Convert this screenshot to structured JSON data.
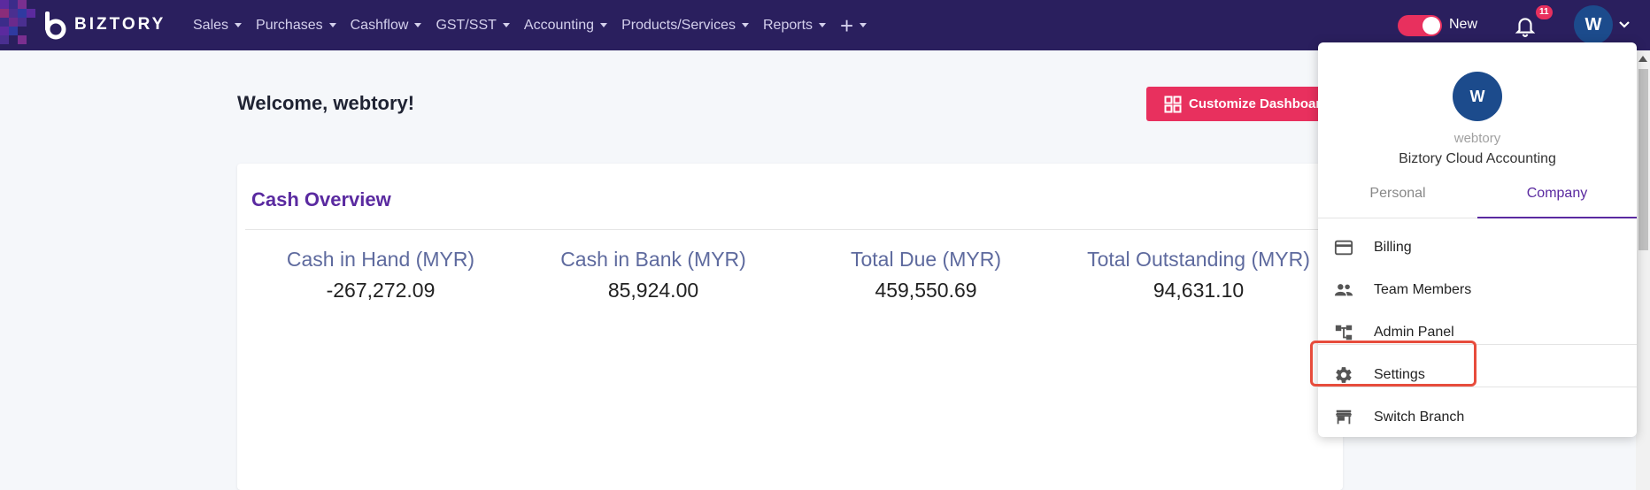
{
  "brand": {
    "name": "BIZTORY"
  },
  "nav": {
    "items": [
      {
        "label": "Sales"
      },
      {
        "label": "Purchases"
      },
      {
        "label": "Cashflow"
      },
      {
        "label": "GST/SST"
      },
      {
        "label": "Accounting"
      },
      {
        "label": "Products/Services"
      },
      {
        "label": "Reports"
      }
    ],
    "plus_icon": "+"
  },
  "header_right": {
    "toggle_label": "New",
    "notification_count": "11",
    "avatar_initial": "W"
  },
  "main": {
    "welcome": "Welcome, webtory!",
    "customize_label": "Customize Dashboard"
  },
  "cash_overview": {
    "title": "Cash Overview",
    "stats": [
      {
        "label": "Cash in Hand (MYR)",
        "value": "-267,272.09"
      },
      {
        "label": "Cash in Bank (MYR)",
        "value": "85,924.00"
      },
      {
        "label": "Total Due (MYR)",
        "value": "459,550.69"
      },
      {
        "label": "Total Outstanding (MYR)",
        "value": "94,631.10"
      }
    ]
  },
  "dropdown": {
    "avatar_initial": "W",
    "username": "webtory",
    "company": "Biztory Cloud Accounting",
    "tabs": [
      {
        "label": "Personal"
      },
      {
        "label": "Company"
      }
    ],
    "active_tab": "Company",
    "items": [
      {
        "label": "Billing",
        "icon": "credit-card-icon"
      },
      {
        "label": "Team Members",
        "icon": "people-icon"
      },
      {
        "label": "Admin Panel",
        "icon": "hierarchy-icon"
      },
      {
        "label": "Settings",
        "icon": "gear-icon"
      },
      {
        "label": "Switch Branch",
        "icon": "store-icon"
      }
    ]
  },
  "colors": {
    "nav_bg": "#2a1f5e",
    "accent": "#e8305e",
    "brand_purple": "#5a2aa0",
    "avatar_blue": "#1c4b8c",
    "highlight": "#e74c3c"
  }
}
